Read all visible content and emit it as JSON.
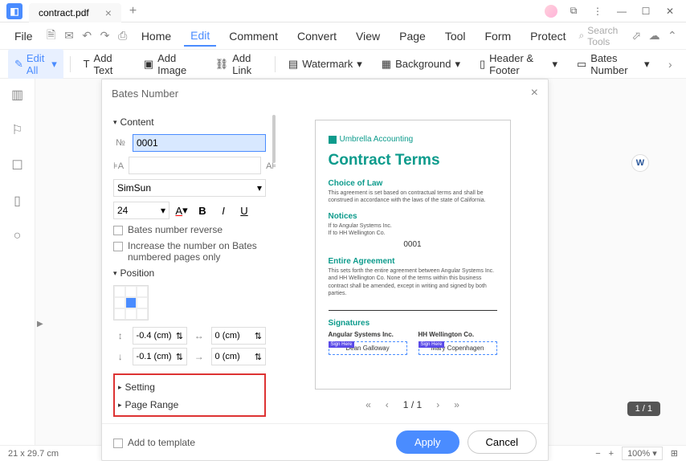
{
  "tab": {
    "title": "contract.pdf"
  },
  "menu": {
    "file": "File",
    "home": "Home",
    "edit": "Edit",
    "comment": "Comment",
    "convert": "Convert",
    "view": "View",
    "page": "Page",
    "tool": "Tool",
    "form": "Form",
    "protect": "Protect",
    "search_placeholder": "Search Tools"
  },
  "toolbar": {
    "edit_all": "Edit All",
    "add_text": "Add Text",
    "add_image": "Add Image",
    "add_link": "Add Link",
    "watermark": "Watermark",
    "background": "Background",
    "header_footer": "Header & Footer",
    "bates_number": "Bates Number"
  },
  "dialog": {
    "title": "Bates Number",
    "content_label": "Content",
    "number_value": "0001",
    "font": "SimSun",
    "size": "24",
    "reverse_label": "Bates number reverse",
    "increase_label": "Increase the number on Bates numbered pages only",
    "position_label": "Position",
    "offset_x": "-0.4 (cm)",
    "offset_y": "-0.1 (cm)",
    "offset_x2": "0 (cm)",
    "offset_y2": "0 (cm)",
    "setting": "Setting",
    "page_range": "Page Range",
    "add_template": "Add to template",
    "apply": "Apply",
    "cancel": "Cancel"
  },
  "preview": {
    "brand": "Umbrella Accounting",
    "title": "Contract Terms",
    "choice": "Choice of Law",
    "choice_text": "This agreement is set based on contractual terms and shall be construed in accordance with the laws of the state of California.",
    "notices": "Notices",
    "notices_text1": "If to Angular Systems Inc.",
    "notices_text2": "If to HH Wellington Co.",
    "bates": "0001",
    "entire": "Entire Agreement",
    "entire_text": "This sets forth the entire agreement between Angular Systems Inc. and HH Wellington Co. None of the terms within this business contract shall be amended, except in writing and signed by both parties.",
    "signatures": "Signatures",
    "sig1_company": "Angular Systems Inc.",
    "sig1_name": "Dean Galloway",
    "sig2_company": "HH Wellington Co.",
    "sig2_name": "Mary Copenhagen",
    "sign_here": "Sign Here"
  },
  "pager": {
    "current": "1",
    "total": "1"
  },
  "status": {
    "dims": "21 x 29.7 cm",
    "zoom": "100%",
    "page_badge": "1 / 1"
  }
}
